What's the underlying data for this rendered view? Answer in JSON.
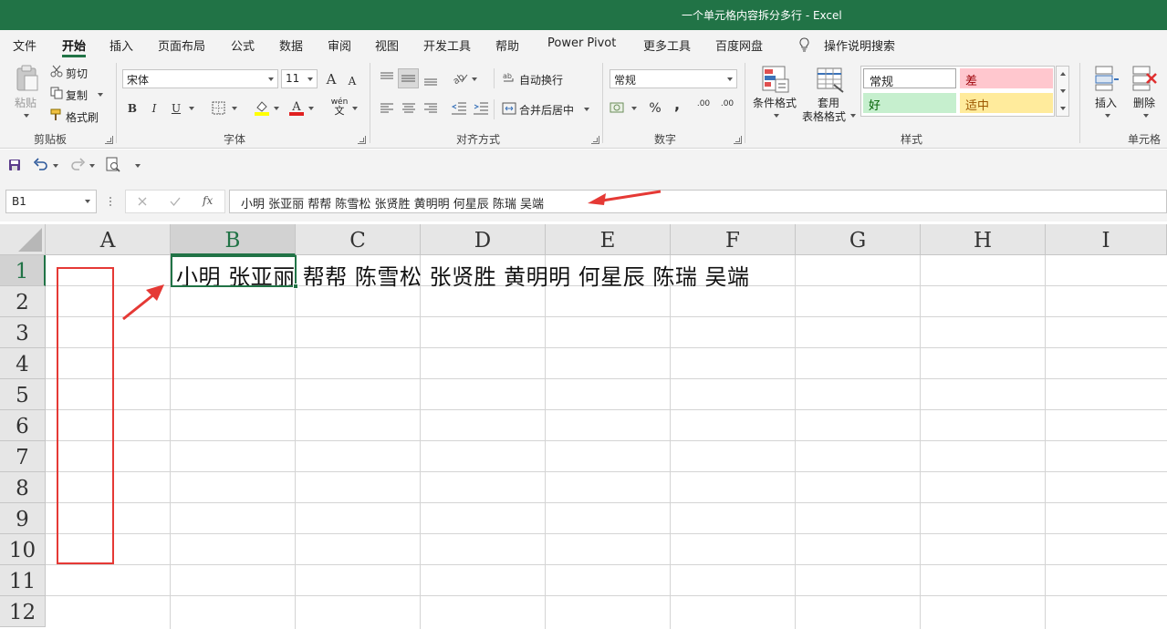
{
  "window": {
    "title": "一个单元格内容拆分多行  -  Excel"
  },
  "menu": {
    "tabs": [
      "文件",
      "开始",
      "插入",
      "页面布局",
      "公式",
      "数据",
      "审阅",
      "视图",
      "开发工具",
      "帮助",
      "Power Pivot",
      "更多工具",
      "百度网盘"
    ],
    "active_tab": "开始",
    "search": "操作说明搜索"
  },
  "ribbon": {
    "clipboard": {
      "paste": "粘贴",
      "cut": "剪切",
      "copy": "复制",
      "format_painter": "格式刷",
      "label": "剪贴板"
    },
    "font": {
      "name": "宋体",
      "size": "11",
      "bold": "B",
      "italic": "I",
      "underline": "U",
      "grow": "A",
      "shrink": "A",
      "phonetic_top": "wén",
      "phonetic_bottom": "文",
      "label": "字体"
    },
    "alignment": {
      "wrap_text": "自动换行",
      "merge_center": "合并后居中",
      "label": "对齐方式"
    },
    "number": {
      "format": "常规",
      "percent": "%",
      "comma": ",",
      "increase_decimal": ".00",
      "decrease_decimal": ".00",
      "label": "数字"
    },
    "styles": {
      "conditional": "条件格式",
      "table_top": "套用",
      "table_bottom": "表格格式",
      "normal": "常规",
      "bad": "差",
      "good": "好",
      "neutral": "适中",
      "label": "样式"
    },
    "cells": {
      "insert": "插入",
      "delete": "删除",
      "label": "单元格"
    },
    "colors": {
      "bad_bg": "#ffc7ce",
      "bad_fg": "#9c0006",
      "good_bg": "#c6efce",
      "good_fg": "#006100",
      "neutral_bg": "#ffeb9c",
      "neutral_fg": "#9c5700",
      "accent": "#217346"
    }
  },
  "formula_bar": {
    "name_box": "B1",
    "fx": "fx",
    "content": "小明 张亚丽 帮帮 陈雪松 张贤胜 黄明明 何星辰 陈瑞 吴端"
  },
  "sheet": {
    "columns": [
      "A",
      "B",
      "C",
      "D",
      "E",
      "F",
      "G",
      "H",
      "I"
    ],
    "rows": [
      "1",
      "2",
      "3",
      "4",
      "5",
      "6",
      "7",
      "8",
      "9",
      "10",
      "11",
      "12"
    ],
    "selected_column": "B",
    "selected_row": "1",
    "b1": "小明  张亚丽  帮帮  陈雪松  张贤胜  黄明明  何星辰  陈瑞  吴端"
  },
  "annotations": {
    "color": "#e53935"
  }
}
